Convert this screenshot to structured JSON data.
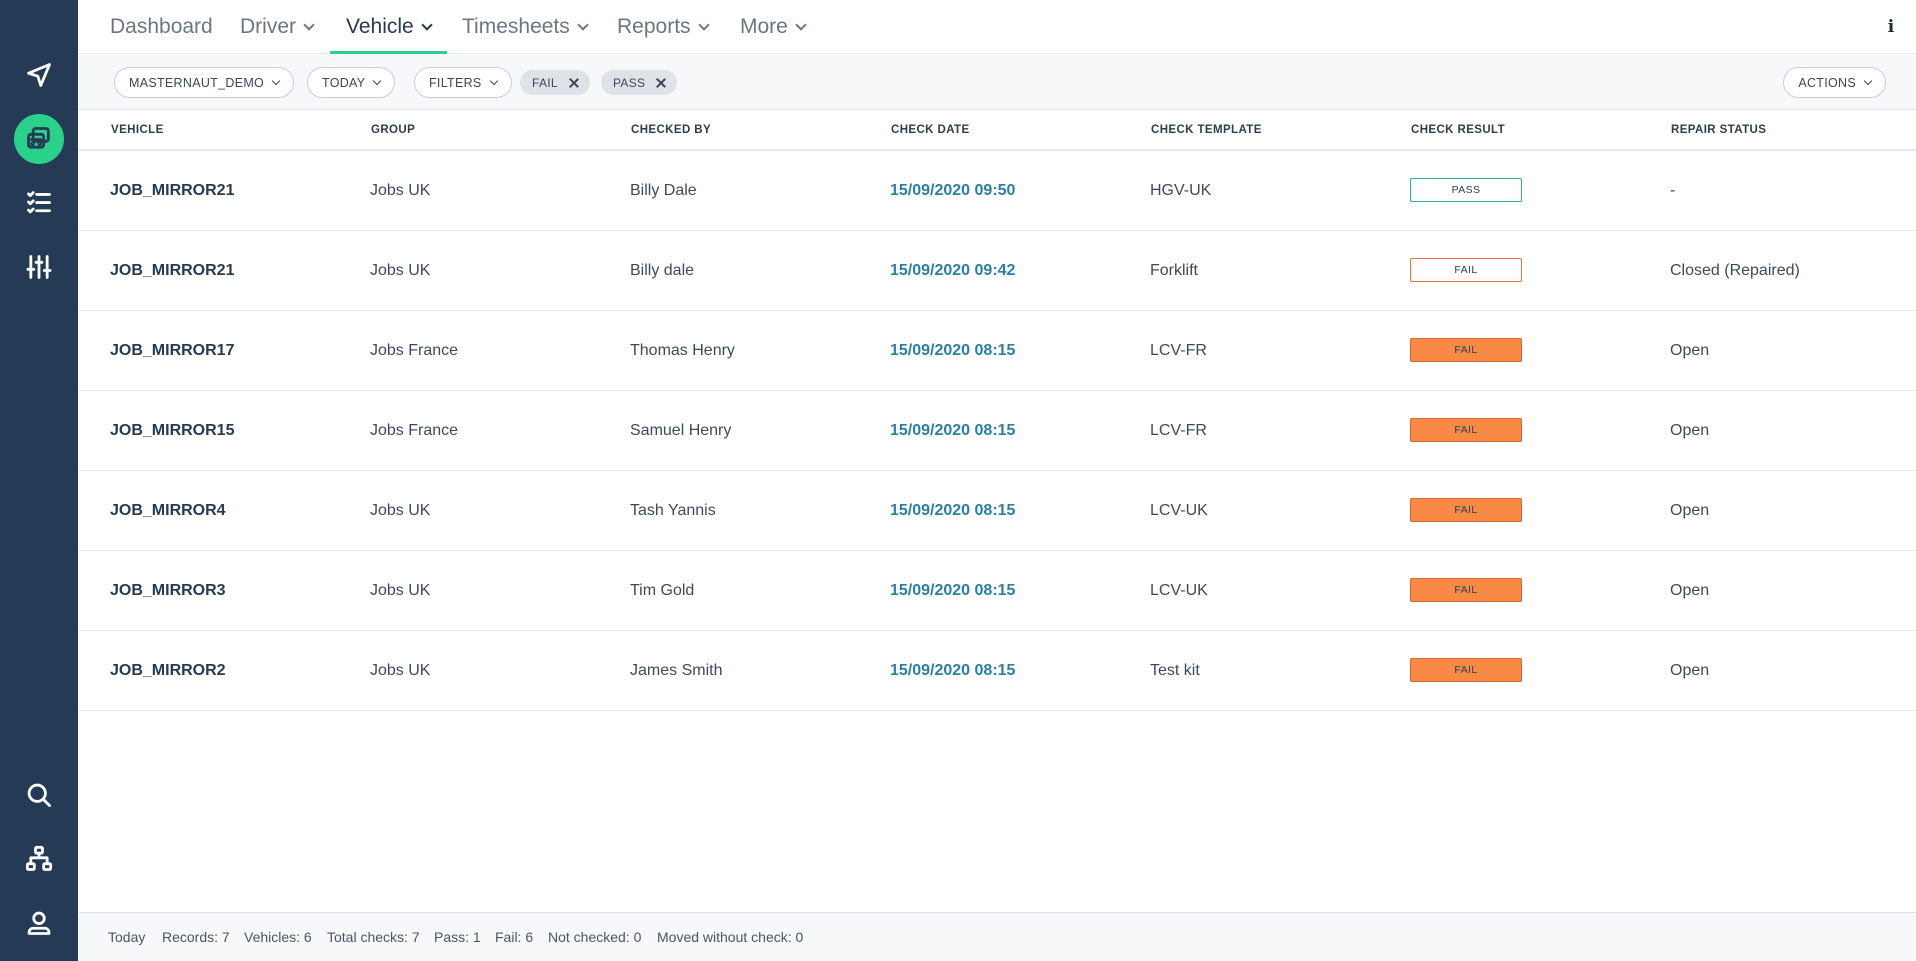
{
  "nav": {
    "items": [
      {
        "label": "Dashboard",
        "dropdown": false,
        "active": false
      },
      {
        "label": "Driver",
        "dropdown": true,
        "active": false
      },
      {
        "label": "Vehicle",
        "dropdown": true,
        "active": true
      },
      {
        "label": "Timesheets",
        "dropdown": true,
        "active": false
      },
      {
        "label": "Reports",
        "dropdown": true,
        "active": false
      },
      {
        "label": "More",
        "dropdown": true,
        "active": false
      }
    ],
    "info_icon": "info-icon"
  },
  "sidebar": {
    "top_icons": [
      "navigate-icon",
      "vehicle-check-icon",
      "checklist-icon",
      "sliders-icon"
    ],
    "bottom_icons": [
      "search-icon",
      "hierarchy-icon",
      "user-icon"
    ],
    "active": "vehicle-check-icon",
    "colors": {
      "background": "#253a55",
      "accent": "#2ad18a"
    }
  },
  "filters": {
    "account": "MASTERNAUT_DEMO",
    "period": "TODAY",
    "filters_label": "FILTERS",
    "tags": [
      "FAIL",
      "PASS"
    ],
    "actions_label": "ACTIONS"
  },
  "table": {
    "columns": [
      "VEHICLE",
      "GROUP",
      "CHECKED BY",
      "CHECK DATE",
      "CHECK TEMPLATE",
      "CHECK RESULT",
      "REPAIR STATUS"
    ],
    "rows": [
      {
        "vehicle": "JOB_MIRROR21",
        "group": "Jobs UK",
        "checked_by": "Billy Dale",
        "check_date": "15/09/2020 09:50",
        "template": "HGV-UK",
        "result": "PASS",
        "result_style": "pass",
        "repair_status": "-"
      },
      {
        "vehicle": "JOB_MIRROR21",
        "group": "Jobs UK",
        "checked_by": "Billy dale",
        "check_date": "15/09/2020 09:42",
        "template": "Forklift",
        "result": "FAIL",
        "result_style": "fail-outline",
        "repair_status": "Closed (Repaired)"
      },
      {
        "vehicle": "JOB_MIRROR17",
        "group": "Jobs France",
        "checked_by": "Thomas Henry",
        "check_date": "15/09/2020 08:15",
        "template": "LCV-FR",
        "result": "FAIL",
        "result_style": "fail",
        "repair_status": "Open"
      },
      {
        "vehicle": "JOB_MIRROR15",
        "group": "Jobs France",
        "checked_by": "Samuel Henry",
        "check_date": "15/09/2020 08:15",
        "template": "LCV-FR",
        "result": "FAIL",
        "result_style": "fail",
        "repair_status": "Open"
      },
      {
        "vehicle": "JOB_MIRROR4",
        "group": "Jobs UK",
        "checked_by": "Tash Yannis",
        "check_date": "15/09/2020 08:15",
        "template": "LCV-UK",
        "result": "FAIL",
        "result_style": "fail",
        "repair_status": "Open"
      },
      {
        "vehicle": "JOB_MIRROR3",
        "group": "Jobs UK",
        "checked_by": "Tim Gold",
        "check_date": "15/09/2020 08:15",
        "template": "LCV-UK",
        "result": "FAIL",
        "result_style": "fail",
        "repair_status": "Open"
      },
      {
        "vehicle": "JOB_MIRROR2",
        "group": "Jobs UK",
        "checked_by": "James Smith",
        "check_date": "15/09/2020 08:15",
        "template": "Test kit",
        "result": "FAIL",
        "result_style": "fail",
        "repair_status": "Open"
      }
    ],
    "colors": {
      "pass": "#2ab394",
      "fail": "#f98a45",
      "date_link": "#2a7fa8"
    }
  },
  "footer": {
    "items": [
      "Today",
      "Records: 7",
      "Vehicles: 6",
      "Total checks: 7",
      "Pass: 1",
      "Fail: 6",
      "Not checked: 0",
      "Moved without check: 0"
    ]
  }
}
